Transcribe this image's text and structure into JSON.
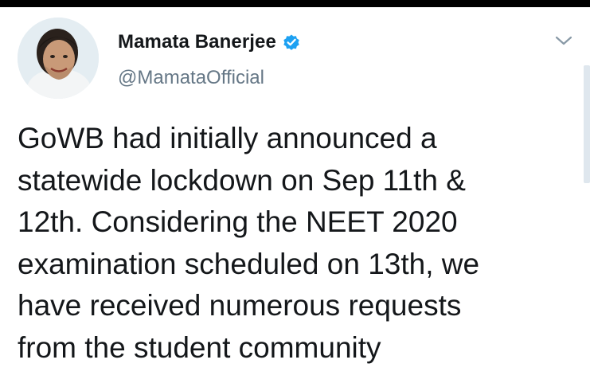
{
  "tweet": {
    "author": {
      "display_name": "Mamata Banerjee",
      "handle": "@MamataOfficial",
      "verified": true,
      "avatar_icon": "profile-photo"
    },
    "menu_icon": "chevron-down-icon",
    "text": "GoWB had initially announced a\nstatewide lockdown on Sep 11th &\n12th. Considering the NEET 2020\nexamination scheduled on 13th, we\nhave received numerous requests\nfrom the student community"
  },
  "colors": {
    "verified_blue": "#1da1f2",
    "handle_gray": "#657786",
    "text_dark": "#14171a",
    "top_bar": "#000000"
  }
}
